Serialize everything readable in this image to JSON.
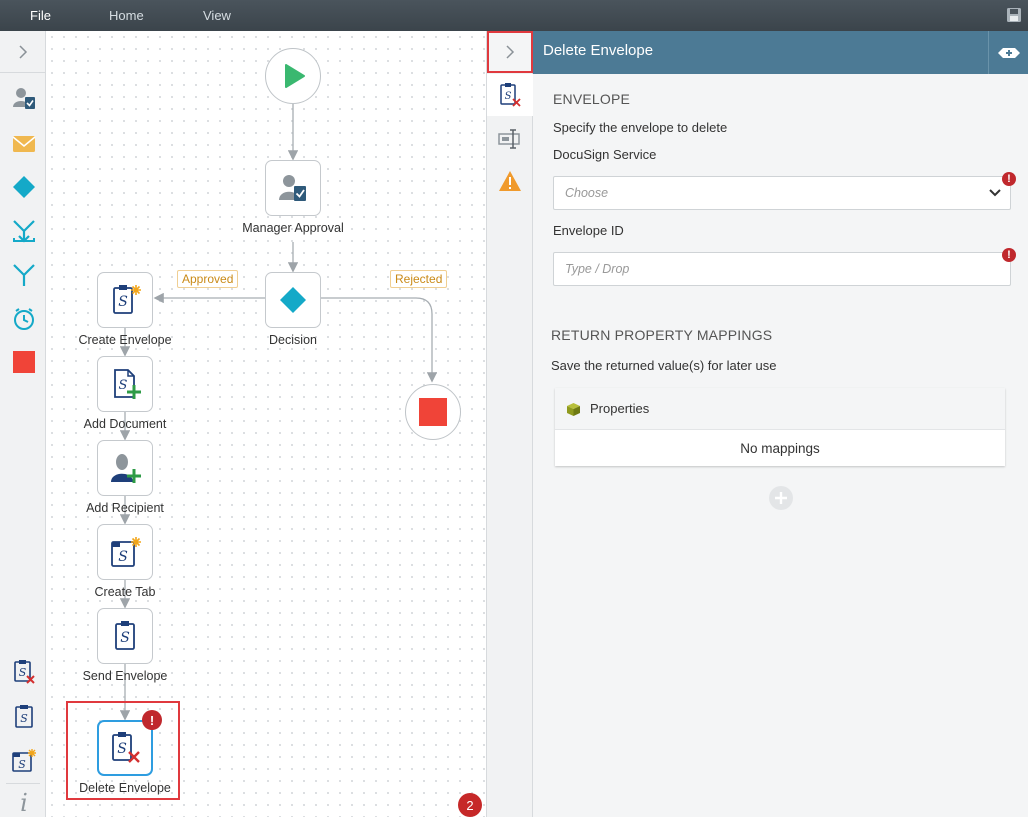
{
  "menu": {
    "file": "File",
    "home": "Home",
    "view": "View"
  },
  "canvas": {
    "nodes": {
      "manager_approval": "Manager Approval",
      "decision": "Decision",
      "create_envelope": "Create Envelope",
      "add_document": "Add Document",
      "add_recipient": "Add Recipient",
      "create_tab": "Create Tab",
      "send_envelope": "Send Envelope",
      "delete_envelope": "Delete Envelope"
    },
    "branches": {
      "approved": "Approved",
      "rejected": "Rejected"
    },
    "error_mark": "!",
    "error_count": "2"
  },
  "panel": {
    "title": "Delete Envelope",
    "envelope_section": "ENVELOPE",
    "envelope_desc": "Specify the envelope to delete",
    "service_label": "DocuSign Service",
    "service_placeholder": "Choose",
    "envelope_id_label": "Envelope ID",
    "envelope_id_placeholder": "Type / Drop",
    "required_mark": "!",
    "return_section": "RETURN PROPERTY MAPPINGS",
    "return_desc": "Save the returned value(s) for later use",
    "properties_label": "Properties",
    "no_mappings": "No mappings"
  },
  "colors": {
    "accent_blue": "#4c7a95",
    "start_green": "#3ab870",
    "stop_red": "#f04438",
    "decision_teal": "#14a9c8",
    "error_red": "#c0282d",
    "branch_orange": "#c98a18",
    "docusign_navy": "#1e3f7a"
  }
}
